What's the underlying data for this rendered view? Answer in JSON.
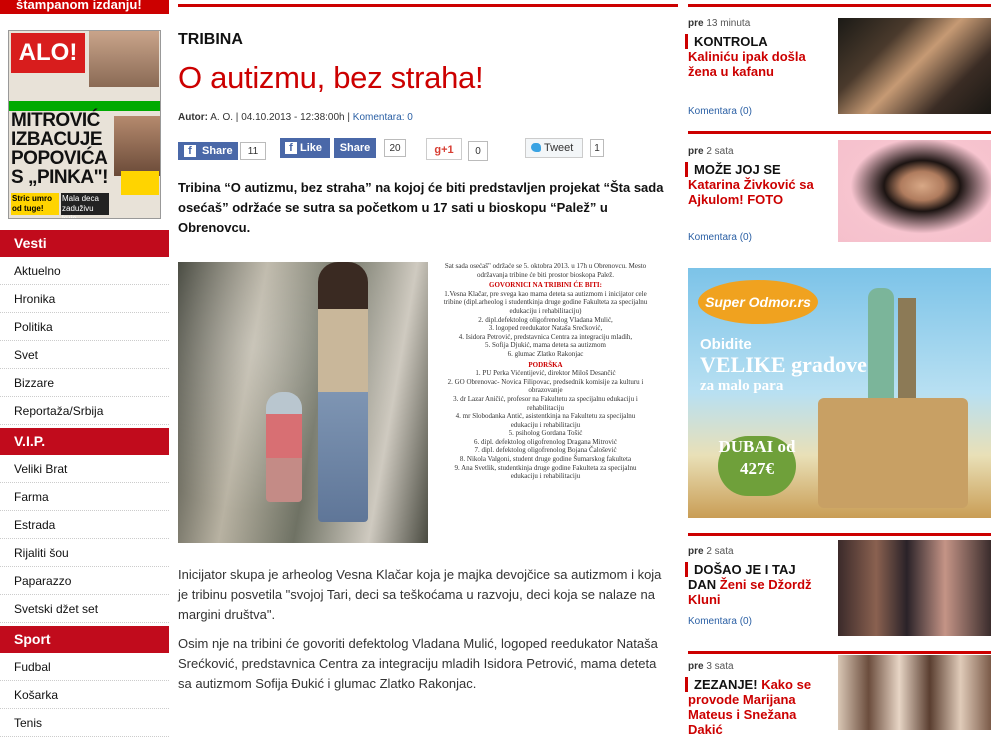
{
  "left": {
    "promo": "štampanom izdanju!",
    "cover": {
      "masthead": "ALO!",
      "headline": "MITROVIĆ IZBACUJE POPOVIĆA S „PINKA\"!",
      "foot1": "Stric umro od tuge!",
      "foot2": "Mala deca zaduživu kuje"
    },
    "sections": [
      {
        "title": "Vesti",
        "items": [
          "Aktuelno",
          "Hronika",
          "Politika",
          "Svet",
          "Bizzare",
          "Reportaža/Srbija"
        ]
      },
      {
        "title": "V.I.P.",
        "items": [
          "Veliki Brat",
          "Farma",
          "Estrada",
          "Rijaliti šou",
          "Paparazzo",
          "Svetski džet set"
        ]
      },
      {
        "title": "Sport",
        "items": [
          "Fudbal",
          "Košarka",
          "Tenis"
        ]
      }
    ]
  },
  "article": {
    "kicker": "TRIBINA",
    "title": "O autizmu, bez straha!",
    "meta_author_label": "Autor:",
    "meta_author": "A. O.",
    "meta_date": "04.10.2013 - 12:38:00h",
    "meta_comments_label": "Komentara:",
    "meta_comments": "0",
    "social": {
      "share_label": "Share",
      "share_count": "11",
      "like_label": "Like",
      "share2_label": "Share",
      "like_count": "20",
      "gplus_label": "g+1",
      "gplus_count": "0",
      "tweet_label": "Tweet",
      "tweet_count": "1"
    },
    "lead": "Tribina “O autizmu, bez straha” na kojoj će biti predstavljen projekat “Šta sada osećaš” održaće se sutra sa početkom u 17 sati u bioskopu “Palež” u Obrenovcu.",
    "flyer": {
      "intro": "Sat sada osećaš\" održaće se 5. oktobra 2013. u 17h u Obrenovcu. Mesto održavanja tribine će biti prostor bioskopa Palež.",
      "heading1": "GOVORNICI NA TRIBINI ĆE BITI:",
      "speakers": [
        "1.Vesna Klačar, pre svega kao mama deteta sa autizmom i inicijator cele tribine (dipl.arheolog i studentkinja druge godine Fakulteta za specijalnu edukaciju i rehabilitaciju)",
        "2. dipl.defektolog oligofrenolog Vladana Mulić,",
        "3. logoped reedukator Nataša Srećković,",
        "4. Isidora Petrović, predstavnica Centra za integraciju mladih,",
        "5. Sofija Djukić, mama deteta sa autizmom",
        "6. glumac Zlatko Rakonjac"
      ],
      "heading2": "PODRŠKA",
      "support": [
        "1. PU Perka Vićentijević, direktor Miloš Desančić",
        "2. GO Obrenovac- Novica Filipovac, predsednik komisije za kulturu i obrazovanje",
        "3. dr Lazar Aničić, profesor na Fakultetu za specijalnu edukaciju i rehabilitaciju",
        "4. mr Slobodanka Antić, asistentkinja na Fakultetu za specijalnu edukaciju i rehabilitaciju",
        "5. psiholog Gordana Tošić",
        "6. dipl. defektolog oligofrenolog Dragana Mitrović",
        "7. dipl. defektolog oligofrenolog Bojana Čalošević",
        "8. Nikola Valgoni, student druge godine Šumarskog fakulteta",
        "9. Ana Svetlik, studentkinja druge godine Fakulteta za specijalnu edukaciju i rehabilitaciju"
      ]
    },
    "para1": "Inicijator skupa je arheolog Vesna Klačar koja je majka devojčice sa autizmom i koja je tribinu posvetila \"svojoj Tari, deci sa teškoćama u razvoju, deci koja se nalaze na margini društva\".",
    "para2": "Osim nje na tribini će govoriti defektolog Vladana Mulić, logoped reedukator Nataša Srećković, predstavnica Centra za integraciju mladih Isidora Petrović, mama deteta sa autizmom Sofija Đukić i glumac Zlatko Rakonjac."
  },
  "right": {
    "items": [
      {
        "time_prefix": "pre",
        "time": "13 minuta",
        "kicker": "KONTROLA",
        "rest": "Kaliniću ipak došla žena u kafanu",
        "comments": "Komentara (0)"
      },
      {
        "time_prefix": "pre",
        "time": "2 sata",
        "kicker": "MOŽE JOJ SE",
        "rest": "Katarina Živković sa Ajkulom! FOTO",
        "comments": "Komentara (0)"
      },
      {
        "time_prefix": "pre",
        "time": "2 sata",
        "kicker": "DOŠAO JE I TAJ DAN",
        "rest": "Ženi se Džordž Kluni",
        "comments": "Komentara (0)"
      },
      {
        "time_prefix": "pre",
        "time": "3 sata",
        "kicker": "ZEZANJE!",
        "rest": "Kako se provode Marijana Mateus i Snežana Dakić",
        "comments": ""
      }
    ],
    "ad": {
      "logo": "Super Odmor.rs",
      "line1": "Obidite",
      "line2": "VELIKE gradove",
      "line3": "za malo para",
      "dubai": "DUBAI od 427€"
    }
  }
}
